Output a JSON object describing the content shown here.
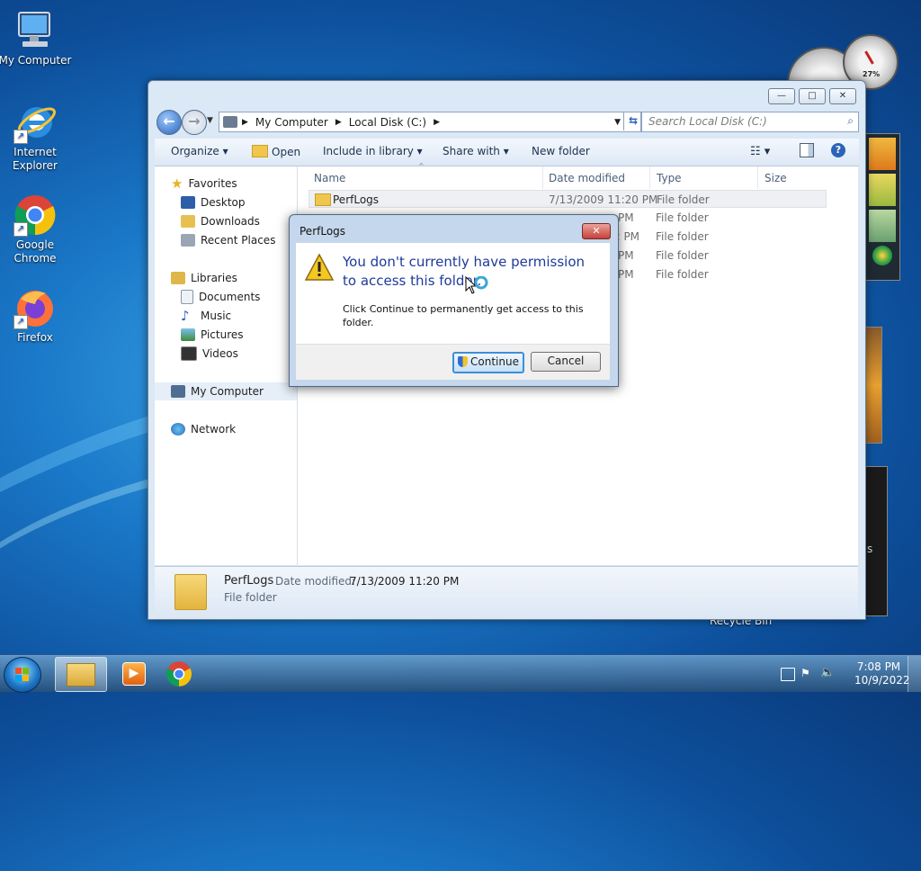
{
  "desktop": {
    "icons": [
      {
        "label_lines": [
          "My Computer"
        ],
        "icon": "computer-icon"
      },
      {
        "label_lines": [
          "Internet",
          "Explorer"
        ],
        "icon": "internet-explorer-icon"
      },
      {
        "label_lines": [
          "Google",
          "Chrome"
        ],
        "icon": "chrome-icon"
      },
      {
        "label_lines": [
          "Firefox"
        ],
        "icon": "firefox-icon"
      }
    ],
    "recycle_bin_label": "Recycle Bin",
    "gadget_partial_text": "s",
    "gauge_value": "27%"
  },
  "explorer": {
    "window_controls": {
      "minimize": "—",
      "maximize": "□",
      "close": "✕"
    },
    "breadcrumb": [
      "My Computer",
      "Local Disk (C:)"
    ],
    "search_placeholder": "Search Local Disk (C:)",
    "toolbar": {
      "organize": "Organize",
      "open": "Open",
      "include": "Include in library",
      "share": "Share with",
      "new_folder": "New folder"
    },
    "nav": {
      "favorites": "Favorites",
      "desktop": "Desktop",
      "downloads": "Downloads",
      "recent": "Recent Places",
      "libraries": "Libraries",
      "documents": "Documents",
      "music": "Music",
      "pictures": "Pictures",
      "videos": "Videos",
      "computer": "My Computer",
      "network": "Network"
    },
    "columns": {
      "name": "Name",
      "date": "Date modified",
      "type": "Type",
      "size": "Size"
    },
    "rows": [
      {
        "name": "PerfLogs",
        "date": "7/13/2009 11:20 PM",
        "type": "File folder"
      },
      {
        "name": "",
        "date": "PM",
        "type": "File folder"
      },
      {
        "name": "",
        "date": "2 PM",
        "type": "File folder"
      },
      {
        "name": "",
        "date": "PM",
        "type": "File folder"
      },
      {
        "name": "",
        "date": "PM",
        "type": "File folder"
      }
    ],
    "details": {
      "name": "PerfLogs",
      "date_label": "Date modified:",
      "date_value": "7/13/2009 11:20 PM",
      "type": "File folder"
    }
  },
  "dialog": {
    "title": "PerfLogs",
    "heading": "You don't currently have permission to access this folder.",
    "body": "Click Continue to permanently get access to this folder.",
    "continue": "Continue",
    "cancel": "Cancel"
  },
  "taskbar": {
    "time": "7:08 PM",
    "date": "10/9/2022"
  },
  "colors": {
    "accent": "#1e4f8e",
    "heading_blue": "#1e3a9a",
    "selection": "#e6eef8"
  }
}
